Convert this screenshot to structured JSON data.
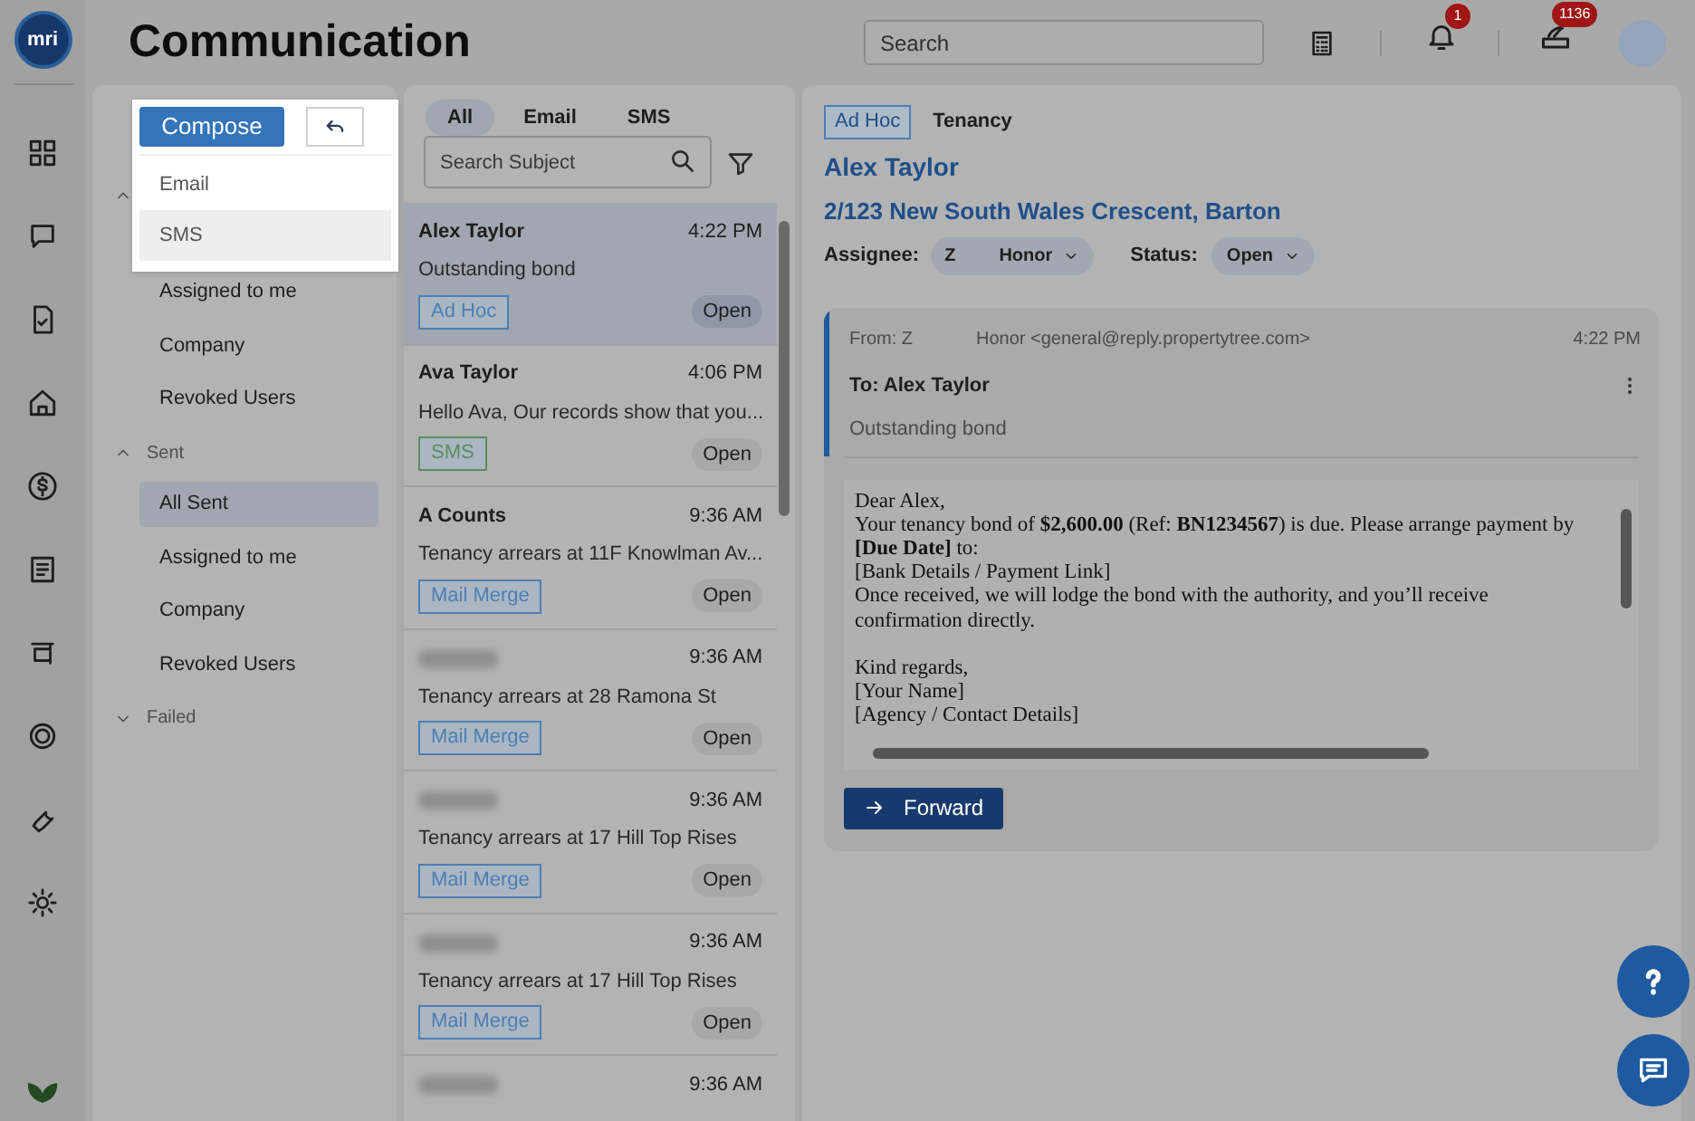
{
  "logo": "mri",
  "header": {
    "title": "Communication",
    "search": {
      "placeholder": "Search"
    },
    "notification_count": "1",
    "message_count": "1136"
  },
  "compose": {
    "label": "Compose",
    "menu": [
      {
        "label": "Email",
        "highlighted": false
      },
      {
        "label": "SMS",
        "highlighted": true
      }
    ]
  },
  "folders": [
    {
      "expanded": true,
      "items": [
        {
          "label": "Assigned to me",
          "selected": false
        },
        {
          "label": "Company",
          "selected": false
        },
        {
          "label": "Revoked Users",
          "selected": false
        }
      ]
    },
    {
      "title": "Sent",
      "expanded": true,
      "items": [
        {
          "label": "All Sent",
          "selected": true
        },
        {
          "label": "Assigned to me",
          "selected": false
        },
        {
          "label": "Company",
          "selected": false
        },
        {
          "label": "Revoked Users",
          "selected": false
        }
      ]
    },
    {
      "title": "Failed",
      "expanded": false
    }
  ],
  "filter_tabs": [
    {
      "label": "All",
      "selected": true
    },
    {
      "label": "Email",
      "selected": false
    },
    {
      "label": "SMS",
      "selected": false
    }
  ],
  "list": {
    "search": {
      "placeholder": "Search Subject"
    },
    "items": [
      {
        "sender": "Alex Taylor",
        "time": "4:22 PM",
        "subject": "Outstanding bond",
        "tag": "Ad Hoc",
        "color": "#4d7fb5",
        "status": "Open",
        "selected": true
      },
      {
        "sender": "Ava Taylor",
        "time": "4:06 PM",
        "subject": "Hello Ava, Our records show that you...",
        "tag": "SMS",
        "color": "#5b8f5b",
        "status": "Open",
        "selected": false
      },
      {
        "sender": "A Counts",
        "time": "9:36 AM",
        "subject": "Tenancy arrears at 11F Knowlman Av...",
        "tag": "Mail Merge",
        "color": "#4d7fb5",
        "status": "Open",
        "selected": false
      },
      {
        "sender_blurred": true,
        "time": "9:36 AM",
        "subject": "Tenancy arrears at 28 Ramona St",
        "tag": "Mail Merge",
        "color": "#4d7fb5",
        "status": "Open",
        "selected": false
      },
      {
        "sender_blurred": true,
        "time": "9:36 AM",
        "subject": "Tenancy arrears at 17 Hill Top Rises",
        "tag": "Mail Merge",
        "color": "#4d7fb5",
        "status": "Open",
        "selected": false
      },
      {
        "sender_blurred": true,
        "time": "9:36 AM",
        "subject": "Tenancy arrears at 17 Hill Top Rises",
        "tag": "Mail Merge",
        "color": "#4d7fb5",
        "status": "Open",
        "selected": false
      },
      {
        "sender_blurred": true,
        "time": "9:36 AM",
        "selected": false
      }
    ]
  },
  "detail": {
    "tags": [
      {
        "label": "Ad Hoc",
        "kind": "boxed"
      },
      {
        "label": "Tenancy",
        "kind": "plain"
      }
    ],
    "name": "Alex Taylor",
    "address": "2/123 New South Wales Crescent, Barton",
    "assignee": {
      "label": "Assignee:",
      "initial": "Z",
      "name": "Honor"
    },
    "status": {
      "label": "Status:",
      "value": "Open"
    },
    "message": {
      "from": "From: Z",
      "sender": "Honor <general@reply.propertytree.com>",
      "time": "4:22 PM",
      "to": "To: Alex Taylor",
      "subject": "Outstanding bond",
      "paragraphs": [
        [
          "Dear Alex,",
          "Your tenancy bond of **$2,600.00** (Ref: **BN1234567**) is due. Please arrange payment by",
          "**[Due Date]** to:",
          "[Bank Details / Payment Link]",
          "Once received, we will lodge the bond with the authority, and you’ll receive",
          "confirmation directly."
        ],
        [
          "Kind regards,",
          "[Your Name]",
          "[Agency / Contact Details]"
        ]
      ]
    },
    "forward": "Forward"
  }
}
